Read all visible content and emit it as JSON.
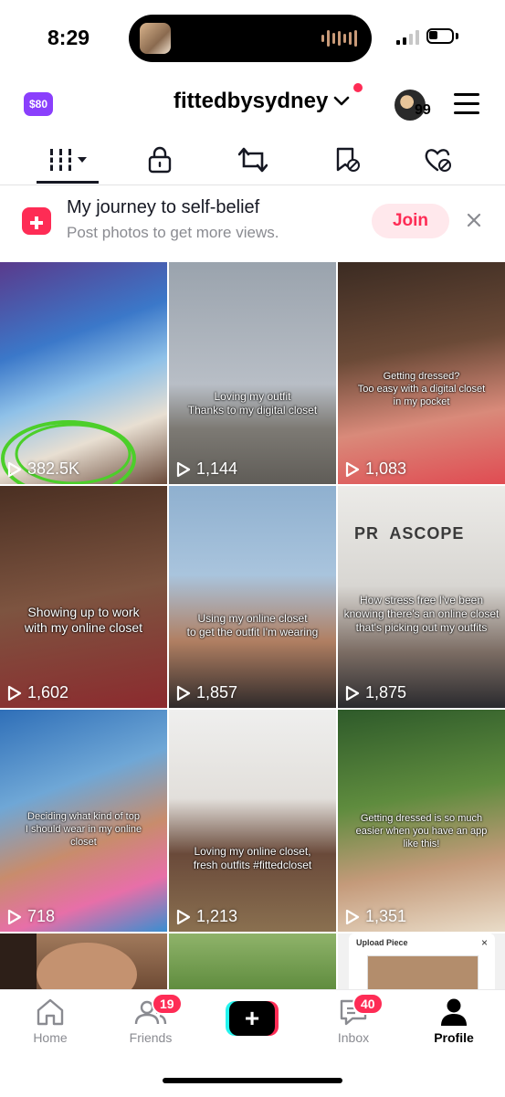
{
  "status": {
    "time": "8:29"
  },
  "header": {
    "coin_label": "$80",
    "username": "fittedbysydney",
    "avatar_count": "99"
  },
  "tabs": [
    {
      "name": "grid-videos-tab",
      "icon": "grid-icon"
    },
    {
      "name": "private-tab",
      "icon": "lock-icon"
    },
    {
      "name": "reposts-tab",
      "icon": "repost-icon"
    },
    {
      "name": "favorites-tab",
      "icon": "bookmark-icon"
    },
    {
      "name": "liked-tab",
      "icon": "heart-icon"
    }
  ],
  "banner": {
    "title": "My journey to self-belief",
    "subtitle": "Post photos to get more views.",
    "join_label": "Join"
  },
  "videos": [
    {
      "views": "382.5K",
      "caption": ""
    },
    {
      "views": "1,144",
      "caption": "Loving my outfit\nThanks to my digital closet"
    },
    {
      "views": "1,083",
      "caption": "Getting dressed?\nToo easy with a digital closet\nin my pocket"
    },
    {
      "views": "1,602",
      "caption": "Showing up to work\nwith my online closet"
    },
    {
      "views": "1,857",
      "caption": "Using my online closet\nto get the outfit I'm wearing"
    },
    {
      "views": "1,875",
      "caption": "How stress free I've been\nknowing there's an online closet\nthat's picking out my outfits"
    },
    {
      "views": "718",
      "caption": "Deciding what kind of top\nI should wear in my online\ncloset"
    },
    {
      "views": "1,213",
      "caption": "Loving my online closet,\nfresh outfits #fittedcloset"
    },
    {
      "views": "1,351",
      "caption": "Getting dressed is so much\neasier when you have an app\nlike this!"
    }
  ],
  "partial_tile": {
    "upload_title": "Upload Piece",
    "close_glyph": "×"
  },
  "tile_sign": "PR  ASCOPE",
  "nav": {
    "home": "Home",
    "friends": "Friends",
    "friends_badge": "19",
    "inbox": "Inbox",
    "inbox_badge": "40",
    "profile": "Profile",
    "create_glyph": "+"
  },
  "colors": {
    "brand_red": "#fe2c55",
    "brand_cyan": "#25f4ee",
    "coin_purple": "#8a3ffc"
  }
}
